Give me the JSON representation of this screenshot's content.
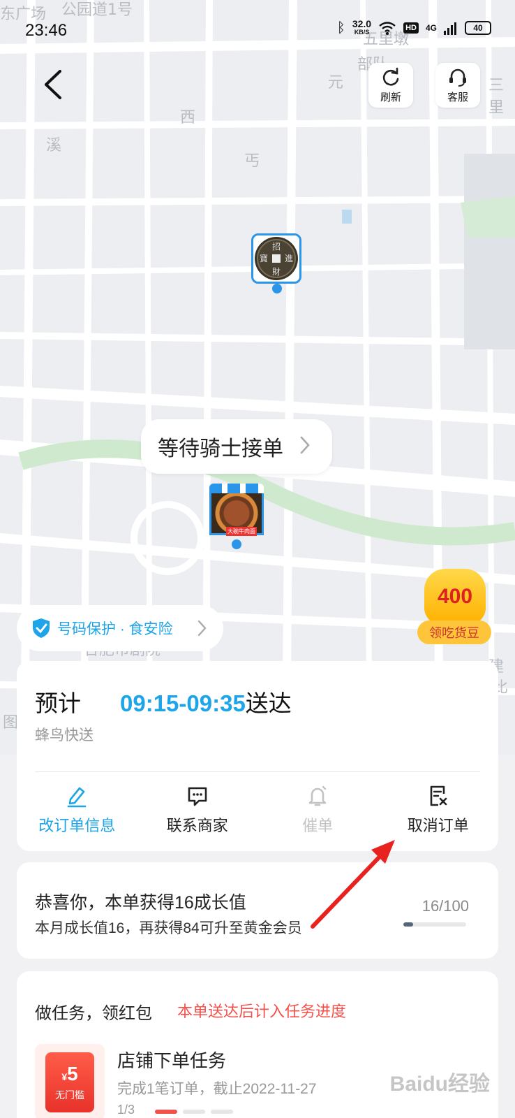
{
  "status_bar": {
    "time": "23:46",
    "speed_value": "32.0",
    "speed_unit": "KB/S",
    "hd": "HD",
    "network": "4G",
    "battery": "40"
  },
  "map": {
    "labels": [
      "东广场",
      "公园道1号",
      "五里墩",
      "西",
      "溪",
      "丐",
      "三里",
      "部队",
      "元",
      "合肥市剧院",
      "建",
      "比",
      "图"
    ],
    "refresh_label": "刷新",
    "service_label": "客服",
    "rider_coin_text": "招 財 進 寶",
    "order_status": "等待骑士接单",
    "shop_sign": "大碗牛肉面",
    "protect_text": "号码保护 · 食安险",
    "reward_amount": "400",
    "reward_label": "领吃货豆"
  },
  "eta": {
    "prefix": "预计",
    "time_range": "09:15-09:35",
    "suffix": "送达",
    "carrier": "蜂鸟快送",
    "actions": [
      {
        "label": "改订单信息",
        "icon": "edit-icon",
        "state": "active"
      },
      {
        "label": "联系商家",
        "icon": "chat-icon",
        "state": "normal"
      },
      {
        "label": "催单",
        "icon": "bell-icon",
        "state": "disabled"
      },
      {
        "label": "取消订单",
        "icon": "cancel-order-icon",
        "state": "normal"
      }
    ]
  },
  "growth": {
    "title": "恭喜你，本单获得16成长值",
    "subtitle": "本月成长值16，再获得84可升至黄金会员",
    "progress_text": "16/100",
    "progress_fraction": 0.16
  },
  "task": {
    "heading": "做任务，领红包",
    "note": "本单送达后计入任务进度",
    "coupon_currency": "¥",
    "coupon_amount": "5",
    "coupon_condition": "无门槛",
    "name": "店铺下单任务",
    "description": "完成1笔订单，截止2022-11-27",
    "page": "1/3"
  },
  "watermark": "Baidu经验",
  "colors": {
    "accent": "#1ea5e9",
    "marker_blue": "#2b95e9",
    "red": "#f2514b",
    "annotation_arrow": "#e8231f"
  }
}
